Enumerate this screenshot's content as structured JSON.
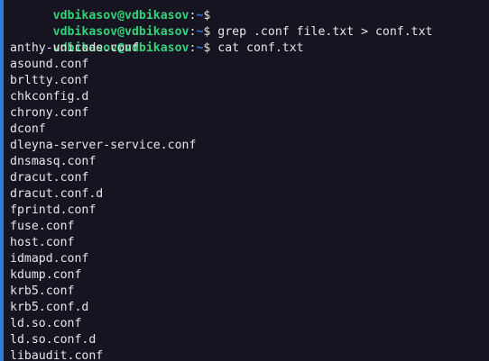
{
  "prompt": {
    "user_host": "vdbikasov@vdbikasov",
    "separator": ":",
    "path": "~",
    "symbol": "$ "
  },
  "commands": [
    "",
    "grep .conf file.txt > conf.txt",
    "cat conf.txt"
  ],
  "output": [
    "anthy-unicode.conf",
    "asound.conf",
    "brltty.conf",
    "chkconfig.d",
    "chrony.conf",
    "dconf",
    "dleyna-server-service.conf",
    "dnsmasq.conf",
    "dracut.conf",
    "dracut.conf.d",
    "fprintd.conf",
    "fuse.conf",
    "host.conf",
    "idmapd.conf",
    "kdump.conf",
    "krb5.conf",
    "krb5.conf.d",
    "ld.so.conf",
    "ld.so.conf.d",
    "libaudit.conf"
  ],
  "colors": {
    "background": "#171421",
    "user_host": "#33d17a",
    "path": "#2a7bde",
    "text": "#e6e6e6"
  }
}
